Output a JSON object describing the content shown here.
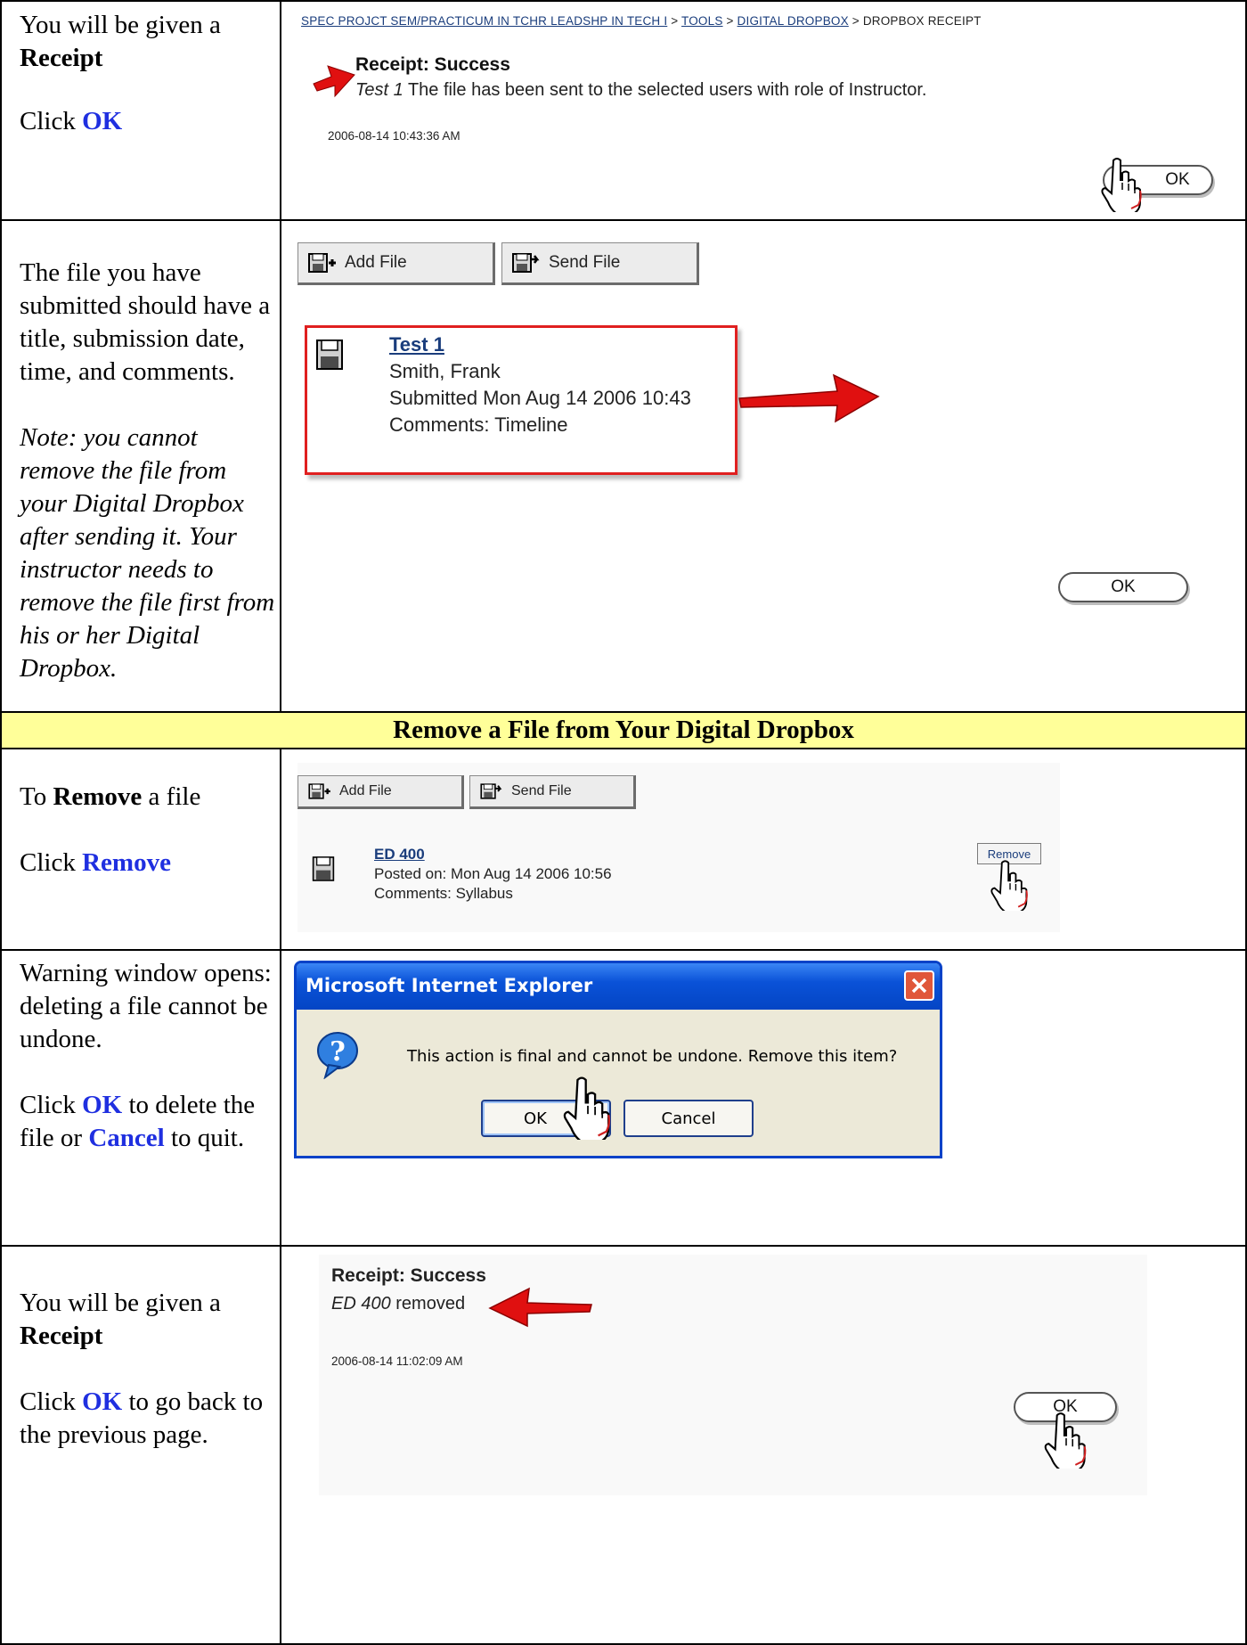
{
  "row1": {
    "instruction": {
      "line1": "You will be given a",
      "bold": "Receipt",
      "click": "Click",
      "ok": "OK"
    },
    "breadcrumb": {
      "course": "SPEC PROJCT SEM/PRACTICUM IN TCHR LEADSHP IN TECH I",
      "sep": " > ",
      "tools": "TOOLS",
      "dropbox": "DIGITAL DROPBOX",
      "current": "DROPBOX RECEIPT"
    },
    "receipt_title": "Receipt: Success",
    "file_name": "Test 1",
    "message": " The file has been sent to the selected users with role of Instructor.",
    "timestamp": "2006-08-14 10:43:36 AM",
    "ok_label": "OK"
  },
  "row2": {
    "instruction": "The file you have submitted should have a title, submission date, time, and comments.",
    "note": "Note: you cannot remove the file from your Digital Dropbox after sending it. Your instructor needs to remove the file first from his or her Digital Dropbox.",
    "add_file": "Add File",
    "send_file": "Send File",
    "file_title": "Test 1",
    "file_author": "Smith, Frank",
    "file_submitted": "Submitted Mon Aug 14 2006 10:43",
    "file_comments": "Comments: Timeline",
    "ok_label": "OK"
  },
  "section_header": "Remove a File from Your Digital Dropbox",
  "row3": {
    "instruction": {
      "to": "To",
      "bold": "Remove",
      "rest": " a file",
      "click": "Click",
      "remove": "Remove"
    },
    "add_file": "Add File",
    "send_file": "Send File",
    "file_title": "ED 400",
    "posted": "Posted on: Mon Aug 14 2006 10:56",
    "comments": "Comments: Syllabus",
    "remove_label": "Remove"
  },
  "row4": {
    "instruction": {
      "line": "Warning window opens: deleting a file cannot be undone.",
      "click": "Click",
      "ok": "OK",
      "mid": " to delete the file or",
      "cancel": "Cancel",
      "end": " to quit."
    },
    "dialog_title": "Microsoft Internet Explorer",
    "dialog_message": "This action is final and cannot be undone. Remove this item?",
    "ok_label": "OK",
    "cancel_label": "Cancel"
  },
  "row5": {
    "instruction": {
      "line1": "You will be given a",
      "bold": "Receipt",
      "click": "Click",
      "ok": "OK",
      "rest": " to go back to the previous page."
    },
    "receipt_title": "Receipt: Success",
    "file_name": "ED 400",
    "message": " removed",
    "timestamp": "2006-08-14 11:02:09 AM",
    "ok_label": "OK"
  },
  "colors": {
    "arrow_red": "#e01010",
    "highlight_box": "#e02020",
    "section_bg": "#ffff99",
    "link_blue": "#1f2fe0",
    "xp_title": "#0a3fd8"
  }
}
